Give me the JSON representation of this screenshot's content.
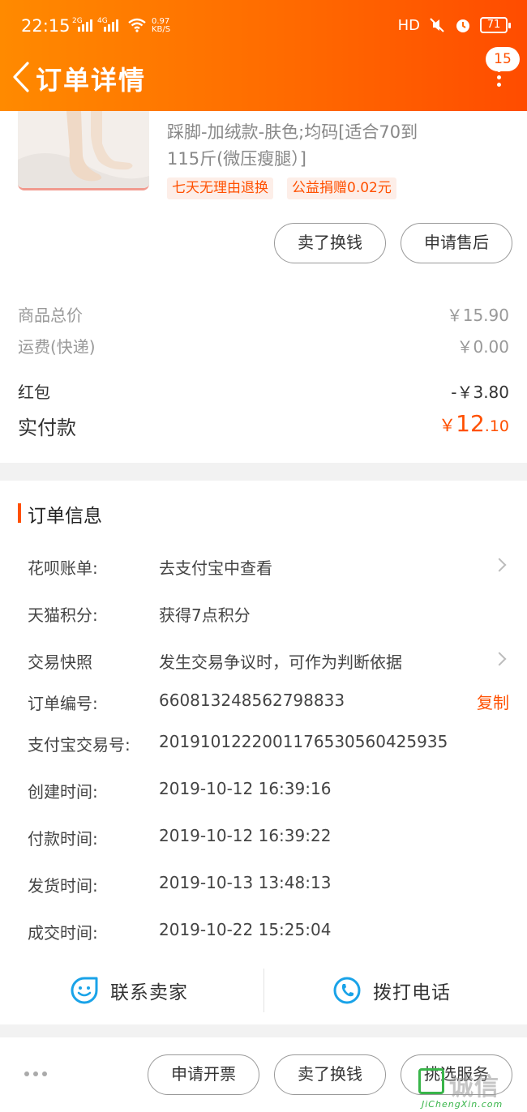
{
  "status_bar": {
    "time": "22:15",
    "sim1": "2G",
    "sim2": "4G",
    "speed_value": "0.97",
    "speed_unit": "KB/S",
    "hd": "HD",
    "battery": "71"
  },
  "nav": {
    "title": "订单详情",
    "badge_count": "15"
  },
  "item": {
    "spec_line1": "踩脚-加绒款-肤色;均码[适合70到",
    "spec_line2": "115斤(微压瘦腿）]",
    "tags": [
      "七天无理由退换",
      "公益捐赠0.02元"
    ],
    "actions": [
      "卖了换钱",
      "申请售后"
    ]
  },
  "summary": {
    "rows": [
      {
        "label": "商品总价",
        "value": "￥15.90"
      },
      {
        "label": "运费(快递)",
        "value": "￥0.00"
      },
      {
        "label": "红包",
        "value": "-￥3.80"
      }
    ],
    "paid_label": "实付款",
    "paid_currency": "￥",
    "paid_int": "12",
    "paid_dec": ".10"
  },
  "order_info": {
    "title": "订单信息",
    "rows": [
      {
        "label": "花呗账单:",
        "value": "去支付宝中查看"
      },
      {
        "label": "天猫积分:",
        "value": "获得7点积分"
      },
      {
        "label": "交易快照",
        "value": "发生交易争议时，可作为判断依据"
      },
      {
        "label": "订单编号:",
        "value": "660813248562798833"
      },
      {
        "label": "支付宝交易号:",
        "value": "2019101222001176530560425935"
      },
      {
        "label": "创建时间:",
        "value": "2019-10-12 16:39:16"
      },
      {
        "label": "付款时间:",
        "value": "2019-10-12 16:39:22"
      },
      {
        "label": "发货时间:",
        "value": "2019-10-13 13:48:13"
      },
      {
        "label": "成交时间:",
        "value": "2019-10-22 15:25:04"
      }
    ],
    "copy_label": "复制"
  },
  "contact": {
    "seller": "联系卖家",
    "phone": "拨打电话"
  },
  "bottom_bar": {
    "buttons": [
      "申请开票",
      "卖了换钱",
      "挑选服务"
    ]
  },
  "watermark": {
    "text": "诚信",
    "sub": "JiChengXin.com"
  },
  "colors": {
    "accent": "#ff5000",
    "header_start": "#ff8a00",
    "header_end": "#ff4c00",
    "icon_blue": "#1aa3e8",
    "watermark_green": "#39b54a"
  }
}
